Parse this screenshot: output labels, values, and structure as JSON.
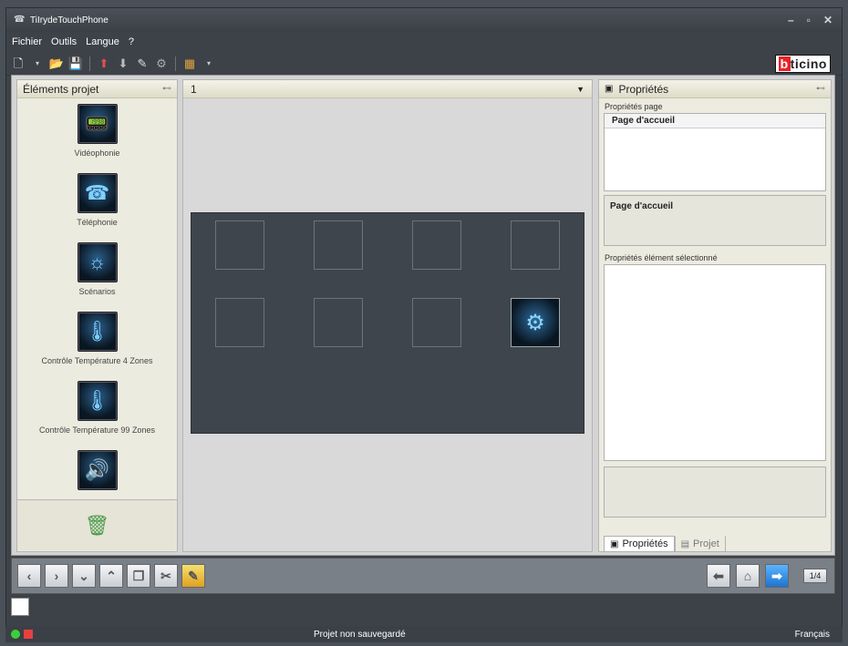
{
  "window": {
    "title": "TiIrydeTouchPhone"
  },
  "menu": [
    "Fichier",
    "Outils",
    "Langue",
    "?"
  ],
  "brand": {
    "prefix": "b",
    "name": "ticino",
    "accent": "#e8222a"
  },
  "left_panel": {
    "title": "Éléments projet",
    "items": [
      {
        "label": "Vidéophonie",
        "icon": "videophone-icon"
      },
      {
        "label": "Téléphonie",
        "icon": "telephone-icon"
      },
      {
        "label": "Scénarios",
        "icon": "scenarios-icon"
      },
      {
        "label": "Contrôle Température 4 Zones",
        "icon": "thermometer-icon"
      },
      {
        "label": "Contrôle Température 99 Zones",
        "icon": "thermometer-icon"
      },
      {
        "label": "",
        "icon": "speaker-icon"
      }
    ]
  },
  "center": {
    "page_selector": "1"
  },
  "right_panel": {
    "title": "Propriétés",
    "page_props_label": "Propriétés page",
    "page_props_header": "Page d'accueil",
    "page_name": "Page d'accueil",
    "selected_props_label": "Propriétés élément sélectionné",
    "tabs": [
      {
        "label": "Propriétés",
        "active": true
      },
      {
        "label": "Projet",
        "active": false
      }
    ]
  },
  "nav": {
    "page_indicator": "1/4"
  },
  "status": {
    "message": "Projet non sauvegardé",
    "language": "Français"
  }
}
